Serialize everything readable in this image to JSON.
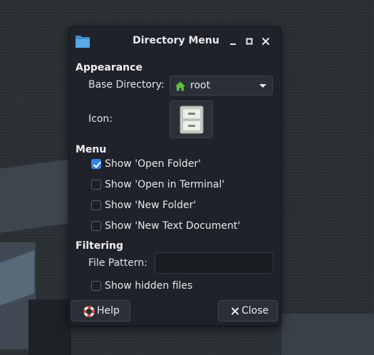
{
  "window": {
    "title": "Directory Menu",
    "app_icon": "folder-icon",
    "controls": [
      "minimize-icon",
      "maximize-icon",
      "close-icon"
    ]
  },
  "appearance": {
    "heading": "Appearance",
    "base_directory_label": "Base Directory:",
    "base_directory_value": "root",
    "base_directory_icon": "home-icon",
    "icon_label": "Icon:",
    "icon_name": "file-cabinet-icon"
  },
  "menu": {
    "heading": "Menu",
    "options": [
      {
        "label": "Show 'Open Folder'",
        "checked": true
      },
      {
        "label": "Show 'Open in Terminal'",
        "checked": false
      },
      {
        "label": "Show 'New Folder'",
        "checked": false
      },
      {
        "label": "Show 'New Text Document'",
        "checked": false
      }
    ]
  },
  "filtering": {
    "heading": "Filtering",
    "file_pattern_label": "File Pattern:",
    "file_pattern_value": "",
    "show_hidden_label": "Show hidden files",
    "show_hidden_checked": false
  },
  "buttons": {
    "help_label": "Help",
    "help_icon": "lifebuoy-icon",
    "close_label": "Close",
    "close_icon": "close-icon"
  },
  "colors": {
    "accent": "#3584e4",
    "dialog_bg": "#1f2329",
    "home_icon": "#5fbf3a",
    "folder_icon": "#5aa9e6"
  }
}
